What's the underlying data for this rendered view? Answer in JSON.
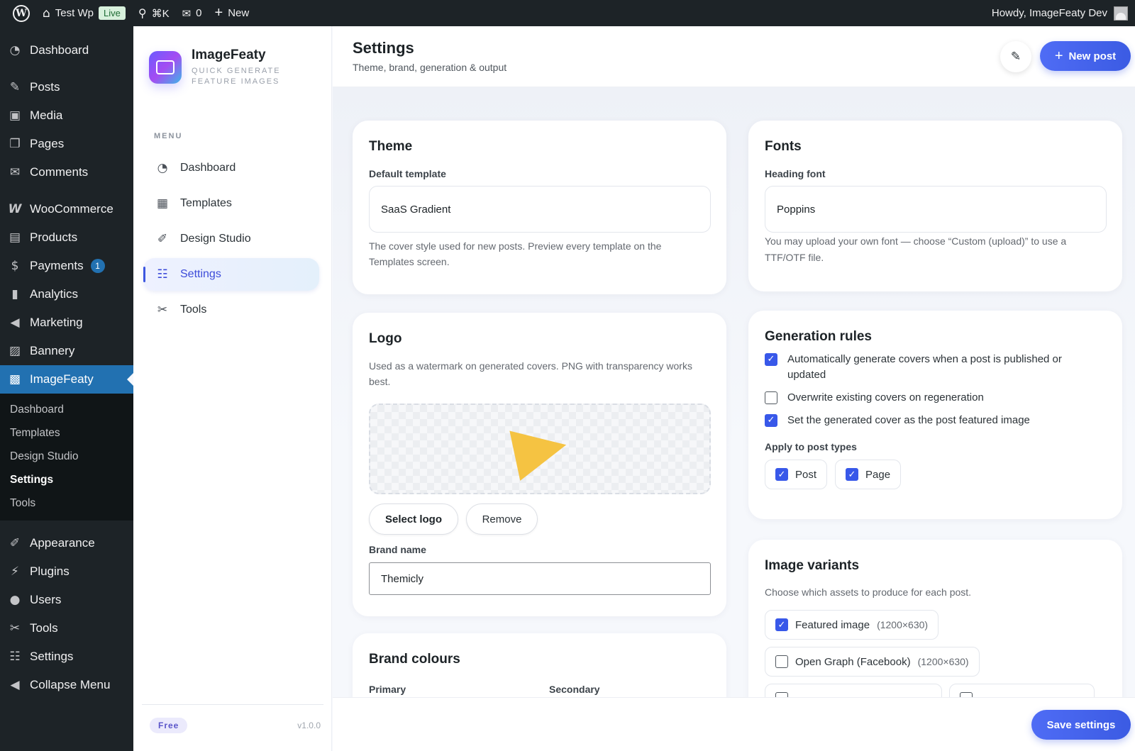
{
  "admin_bar": {
    "site_name": "Test Wp",
    "live_badge": "Live",
    "search_shortcut": "⌘K",
    "comments_count": "0",
    "new_label": "New",
    "howdy": "Howdy, ImageFeaty Dev"
  },
  "wp_menu": {
    "items_top": [
      {
        "label": "Dashboard",
        "icon": "dashboard-icon"
      },
      {
        "label": "Posts",
        "icon": "pin-icon"
      },
      {
        "label": "Media",
        "icon": "media-icon"
      },
      {
        "label": "Pages",
        "icon": "pages-icon"
      },
      {
        "label": "Comments",
        "icon": "comment-icon"
      },
      {
        "label": "WooCommerce",
        "icon": "woocommerce-icon"
      },
      {
        "label": "Products",
        "icon": "archive-icon"
      },
      {
        "label": "Payments",
        "icon": "payments-icon",
        "badge": "1"
      },
      {
        "label": "Analytics",
        "icon": "bar-chart-icon"
      },
      {
        "label": "Marketing",
        "icon": "megaphone-icon"
      },
      {
        "label": "Bannery",
        "icon": "image-icon"
      },
      {
        "label": "ImageFeaty",
        "icon": "imagefeaty-icon"
      }
    ],
    "submenu": [
      {
        "label": "Dashboard"
      },
      {
        "label": "Templates"
      },
      {
        "label": "Design Studio"
      },
      {
        "label": "Settings"
      },
      {
        "label": "Tools"
      }
    ],
    "items_bottom": [
      {
        "label": "Appearance",
        "icon": "brush-icon"
      },
      {
        "label": "Plugins",
        "icon": "plugin-icon"
      },
      {
        "label": "Users",
        "icon": "user-icon"
      },
      {
        "label": "Tools",
        "icon": "wrench-icon"
      },
      {
        "label": "Settings",
        "icon": "sliders-icon"
      },
      {
        "label": "Collapse Menu",
        "icon": "collapse-icon"
      }
    ]
  },
  "plugin": {
    "name": "ImageFeaty",
    "tagline_1": "QUICK GENERATE",
    "tagline_2": "FEATURE IMAGES",
    "menu_label": "MENU",
    "nav": [
      {
        "label": "Dashboard",
        "icon": "dashboard-icon"
      },
      {
        "label": "Templates",
        "icon": "templates-icon"
      },
      {
        "label": "Design Studio",
        "icon": "brush-icon"
      },
      {
        "label": "Settings",
        "icon": "settings-icon"
      },
      {
        "label": "Tools",
        "icon": "wrench-icon"
      }
    ],
    "plan": "Free",
    "version": "v1.0.0"
  },
  "header": {
    "title": "Settings",
    "subtitle": "Theme, brand, generation & output",
    "new_post": "New post"
  },
  "theme_card": {
    "title": "Theme",
    "label": "Default template",
    "value": "SaaS Gradient",
    "help": "The cover style used for new posts. Preview every template on the Templates screen."
  },
  "fonts_card": {
    "title": "Fonts",
    "label": "Heading font",
    "value": "Poppins",
    "help": "You may upload your own font — choose “Custom (upload)” to use a TTF/OTF file."
  },
  "logo_card": {
    "title": "Logo",
    "help": "Used as a watermark on generated covers. PNG with transparency works best.",
    "select": "Select logo",
    "remove": "Remove",
    "brand_label": "Brand name",
    "brand_value": "Themicly"
  },
  "generation_card": {
    "title": "Generation rules",
    "rules": [
      {
        "label": "Automatically generate covers when a post is published or updated",
        "checked": true
      },
      {
        "label": "Overwrite existing covers on regeneration",
        "checked": false
      },
      {
        "label": "Set the generated cover as the post featured image",
        "checked": true
      }
    ],
    "post_types_label": "Apply to post types",
    "post_types": [
      {
        "label": "Post",
        "checked": true
      },
      {
        "label": "Page",
        "checked": true
      }
    ]
  },
  "variants_card": {
    "title": "Image variants",
    "help": "Choose which assets to produce for each post.",
    "variants": [
      {
        "label": "Featured image",
        "size": "(1200×630)",
        "checked": true
      },
      {
        "label": "Open Graph (Facebook)",
        "size": "(1200×630)",
        "checked": false
      }
    ]
  },
  "colours_card": {
    "title": "Brand colours",
    "primary": "Primary",
    "secondary": "Secondary"
  },
  "footer": {
    "save": "Save settings"
  },
  "colors": {
    "accent": "#3b5be3",
    "wp_admin": "#1d2327",
    "wp_active": "#2271b1"
  }
}
